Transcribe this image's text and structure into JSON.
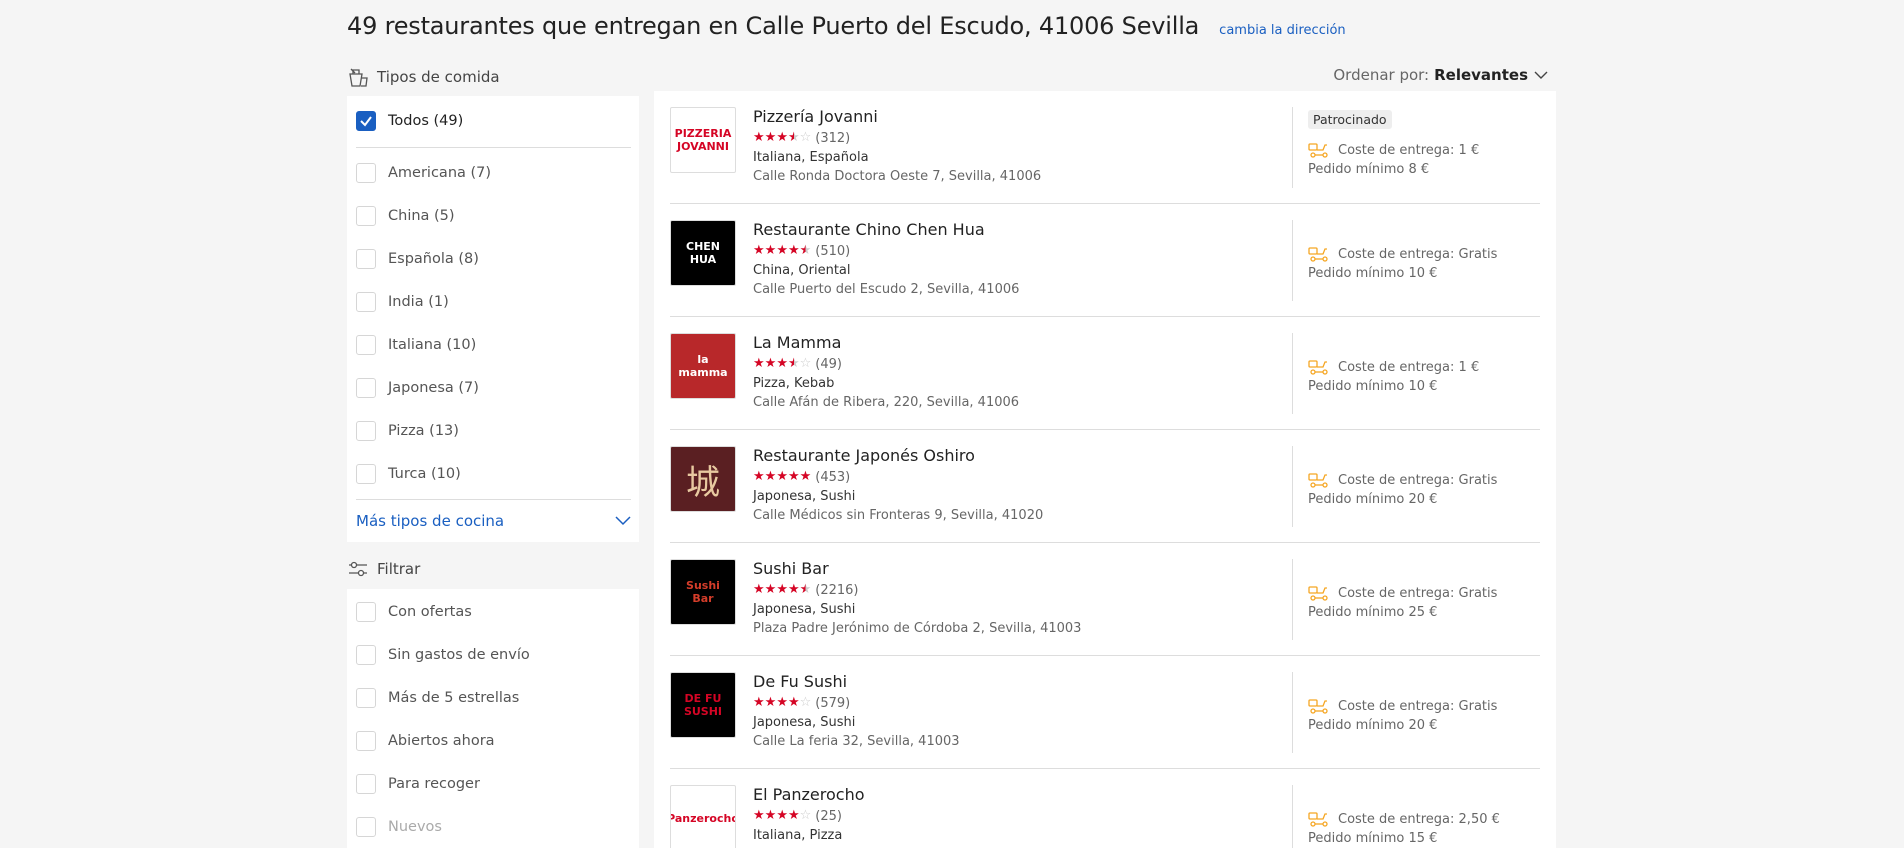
{
  "header": {
    "title": "49 restaurantes que entregan en Calle Puerto del Escudo, 41006 Sevilla",
    "change_address": "cambia la dirección"
  },
  "sort": {
    "label": "Ordenar por:",
    "value": "Relevantes"
  },
  "cuisine_filter": {
    "title": "Tipos de comida",
    "all": {
      "label": "Todos (49)",
      "checked": true
    },
    "options": [
      {
        "label": "Americana (7)"
      },
      {
        "label": "China (5)"
      },
      {
        "label": "Española (8)"
      },
      {
        "label": "India (1)"
      },
      {
        "label": "Italiana (10)"
      },
      {
        "label": "Japonesa (7)"
      },
      {
        "label": "Pizza (13)"
      },
      {
        "label": "Turca (10)"
      }
    ],
    "more": "Más tipos de cocina"
  },
  "filter": {
    "title": "Filtrar",
    "options": [
      {
        "label": "Con ofertas"
      },
      {
        "label": "Sin gastos de envío"
      },
      {
        "label": "Más de 5 estrellas"
      },
      {
        "label": "Abiertos ahora"
      },
      {
        "label": "Para recoger"
      },
      {
        "label": "Nuevos"
      }
    ]
  },
  "restaurants": [
    {
      "name": "Pizzería Jovanni",
      "rating": 3.5,
      "reviews": "(312)",
      "cuisine": "Italiana, Española",
      "address": "Calle Ronda Doctora Oeste 7, Sevilla, 41006",
      "sponsored": "Patrocinado",
      "delivery": "Coste de entrega: 1 €",
      "minimum": "Pedido mínimo 8 €",
      "logo_text": "PIZZERIA JOVANNI",
      "logo_bg": "#ffffff",
      "logo_fg": "#d50525"
    },
    {
      "name": "Restaurante Chino Chen Hua",
      "rating": 4.5,
      "reviews": "(510)",
      "cuisine": "China, Oriental",
      "address": "Calle Puerto del Escudo 2, Sevilla, 41006",
      "sponsored": "",
      "delivery": "Coste de entrega: Gratis",
      "minimum": "Pedido mínimo 10 €",
      "logo_text": "CHEN HUA",
      "logo_bg": "#000000",
      "logo_fg": "#ffffff"
    },
    {
      "name": "La Mamma",
      "rating": 3.5,
      "reviews": "(49)",
      "cuisine": "Pizza, Kebab",
      "address": "Calle Afán de Ribera, 220, Sevilla, 41006",
      "sponsored": "",
      "delivery": "Coste de entrega: 1 €",
      "minimum": "Pedido mínimo 10 €",
      "logo_text": "la mamma",
      "logo_bg": "#b8282a",
      "logo_fg": "#ffffff"
    },
    {
      "name": "Restaurante Japonés Oshiro",
      "rating": 5,
      "reviews": "(453)",
      "cuisine": "Japonesa, Sushi",
      "address": "Calle Médicos sin Fronteras 9, Sevilla, 41020",
      "sponsored": "",
      "delivery": "Coste de entrega: Gratis",
      "minimum": "Pedido mínimo 20 €",
      "logo_text": "城",
      "logo_bg": "#5a1f22",
      "logo_fg": "#e8c9a0"
    },
    {
      "name": "Sushi Bar",
      "rating": 4.5,
      "reviews": "(2216)",
      "cuisine": "Japonesa, Sushi",
      "address": "Plaza Padre Jerónimo de Córdoba 2, Sevilla, 41003",
      "sponsored": "",
      "delivery": "Coste de entrega: Gratis",
      "minimum": "Pedido mínimo 25 €",
      "logo_text": "Sushi Bar",
      "logo_bg": "#000000",
      "logo_fg": "#d43d2a"
    },
    {
      "name": "De Fu Sushi",
      "rating": 4,
      "reviews": "(579)",
      "cuisine": "Japonesa, Sushi",
      "address": "Calle La feria 32, Sevilla, 41003",
      "sponsored": "",
      "delivery": "Coste de entrega: Gratis",
      "minimum": "Pedido mínimo 20 €",
      "logo_text": "DE FU SUSHI",
      "logo_bg": "#000000",
      "logo_fg": "#d50525"
    },
    {
      "name": "El Panzerocho",
      "rating": 4,
      "reviews": "(25)",
      "cuisine": "Italiana, Pizza",
      "address": "",
      "sponsored": "",
      "delivery": "Coste de entrega: 2,50 €",
      "minimum": "Pedido mínimo 15 €",
      "logo_text": "Panzerocho",
      "logo_bg": "#ffffff",
      "logo_fg": "#d50525"
    }
  ],
  "colors": {
    "accent": "#1a5fc1",
    "star": "#d50525",
    "delivery_icon": "#f5a623"
  }
}
